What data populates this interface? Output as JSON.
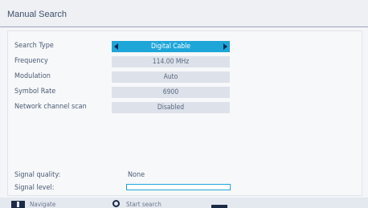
{
  "title": "Manual Search",
  "fields": [
    {
      "label": "Search Type",
      "value": "Digital Cable",
      "selected": true
    },
    {
      "label": "Frequency",
      "value": "114.00 MHz",
      "selected": false
    },
    {
      "label": "Modulation",
      "value": "Auto",
      "selected": false
    },
    {
      "label": "Symbol Rate",
      "value": "6900",
      "selected": false
    },
    {
      "label": "Network channel scan",
      "value": "Disabled",
      "selected": false
    }
  ],
  "signal": {
    "quality_label": "Signal quality:",
    "quality_value": "None",
    "level_label": "Signal level:",
    "level_fraction": 0
  },
  "footer": {
    "navigate_label": "Navigate",
    "start_label": "Start search"
  },
  "colors": {
    "selected_bg": "#1ea6d9",
    "arrow": "#0b2d56"
  },
  "icons": {
    "navigate": "navigate-icon",
    "ok": "ok-button-icon",
    "left": "arrow-left-icon",
    "right": "arrow-right-icon"
  }
}
